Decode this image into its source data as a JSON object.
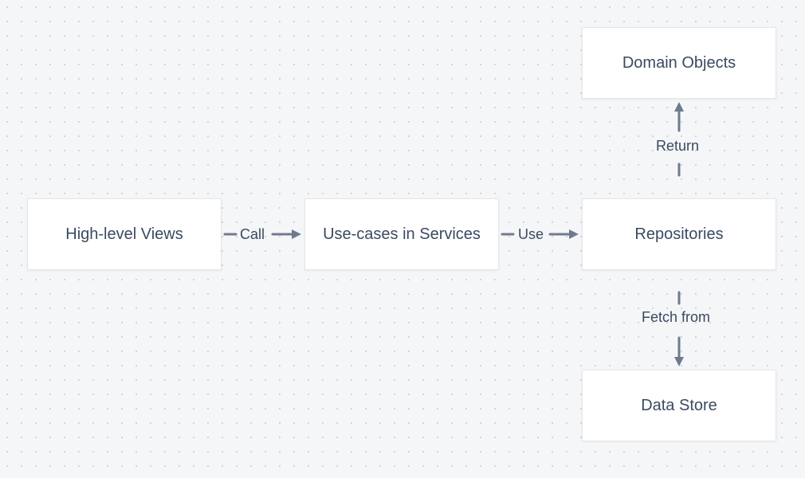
{
  "nodes": {
    "views": {
      "label": "High-level Views"
    },
    "services": {
      "label": "Use-cases in Services"
    },
    "repositories": {
      "label": "Repositories"
    },
    "domain_objects": {
      "label": "Domain Objects"
    },
    "data_store": {
      "label": "Data Store"
    }
  },
  "edges": {
    "call": {
      "label": "Call"
    },
    "use": {
      "label": "Use"
    },
    "return": {
      "label": "Return"
    },
    "fetch_from": {
      "label": "Fetch from"
    }
  }
}
